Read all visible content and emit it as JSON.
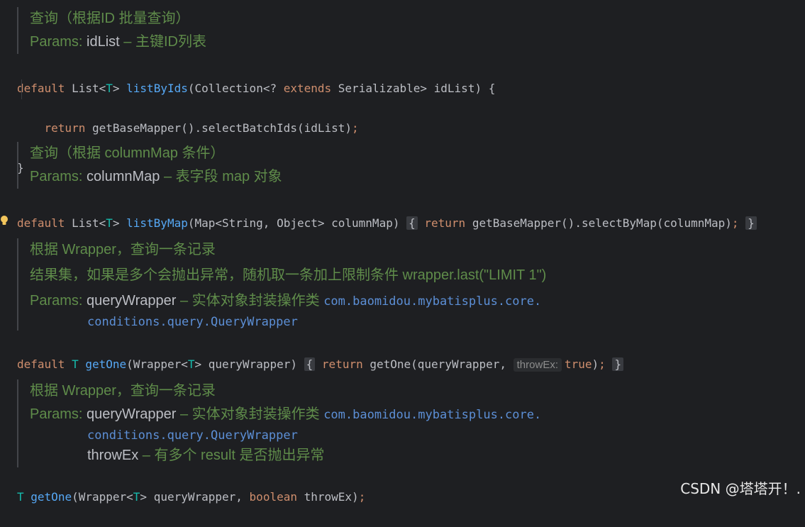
{
  "doc1": {
    "line1": "查询（根据ID 批量查询）",
    "params_label": "Params:",
    "param_name": "idList",
    "param_desc": " – 主键ID列表"
  },
  "code1": {
    "line1": {
      "kw": "default",
      "type": "List<",
      "gen": "T",
      "type2": "> ",
      "fn": "listByIds",
      "rest": "(Collection<? ",
      "kw2": "extends",
      "rest2": " Serializable> idList) {"
    },
    "line2": {
      "kw": "return",
      "rest": " getBaseMapper().selectBatchIds(idList)",
      "semi": ";"
    },
    "line3": "}"
  },
  "doc2": {
    "line1": "查询（根据 columnMap 条件）",
    "params_label": "Params:",
    "param_name": "columnMap",
    "param_desc": " – 表字段 map 对象"
  },
  "code2": {
    "kw": "default",
    "type": " List<",
    "gen": "T",
    "type2": "> ",
    "fn": "listByMap",
    "sig": "(Map<String, Object> columnMap)",
    "open": "{",
    "ret": "return",
    "body": " getBaseMapper().selectByMap(columnMap)",
    "semi": ";",
    "close": "}"
  },
  "doc3": {
    "line1": "根据 Wrapper，查询一条记录",
    "line2": "结果集，如果是多个会抛出异常，随机取一条加上限制条件 wrapper.last(\"LIMIT 1\")",
    "params_label": "Params:",
    "param_name": "queryWrapper",
    "param_desc": " – 实体对象封装操作类 ",
    "link1": "com.baomidou.mybatisplus.core.",
    "link2": "conditions.query.QueryWrapper"
  },
  "code3": {
    "kw": "default",
    "gen": "T",
    "fn": "getOne",
    "sig": "(Wrapper<",
    "sig2": "> queryWrapper)",
    "open": "{",
    "ret": "return",
    "body": " getOne(queryWrapper, ",
    "hint": "throwEx:",
    "val": "true",
    "tail": ")",
    "semi": ";",
    "close": "}"
  },
  "doc4": {
    "line1": "根据 Wrapper，查询一条记录",
    "params_label": "Params:",
    "param_name": "queryWrapper",
    "param_desc": " – 实体对象封装操作类 ",
    "link1": "com.baomidou.mybatisplus.core.",
    "link2": "conditions.query.QueryWrapper",
    "param2_name": "throwEx",
    "param2_desc": " – 有多个 result 是否抛出异常"
  },
  "code4": {
    "gen": "T",
    "fn": "getOne",
    "sig": "(Wrapper<",
    "sig2": "> queryWrapper, ",
    "kw": "boolean",
    "tail": " throwEx)",
    "semi": ";"
  },
  "watermark": "CSDN @塔塔开！.",
  "colors": {
    "background": "#1e1f22",
    "keyword": "#cf8e6d",
    "function": "#56a8f5",
    "doc": "#5f8c4a",
    "link": "#5c8fd6"
  }
}
